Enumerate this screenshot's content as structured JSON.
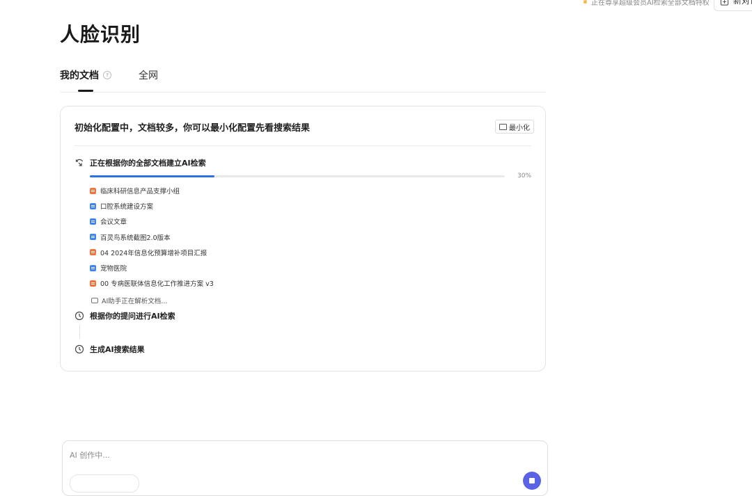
{
  "header": {
    "vip_notice": "正在尊享超级会员AI检索全部文档特权",
    "new_chat_label": "新对话"
  },
  "page": {
    "title": "人脸识别"
  },
  "tabs": [
    {
      "label": "我的文档",
      "active": true
    },
    {
      "label": "全网",
      "active": false
    }
  ],
  "card": {
    "title": "初始化配置中，文档较多，你可以最小化配置先看搜索结果",
    "minimize_label": "最小化",
    "steps": [
      {
        "label": "正在根据你的全部文档建立AI检索",
        "status": "in-progress"
      },
      {
        "label": "根据你的提问进行AI检索",
        "status": "pending"
      },
      {
        "label": "生成AI搜索结果",
        "status": "pending"
      }
    ],
    "progress": {
      "percent": 30,
      "label": "30%"
    },
    "documents": [
      {
        "name": "临床科研信息产品支撑小组",
        "icon": "orange-doc-icon"
      },
      {
        "name": "口腔系统建设方案",
        "icon": "blue-doc-icon"
      },
      {
        "name": "会议文章",
        "icon": "blue-doc-icon"
      },
      {
        "name": "百灵鸟系统截图2.0版本",
        "icon": "blue-doc-icon"
      },
      {
        "name": "04 2024年信息化预算增补项目汇报",
        "icon": "orange-doc-icon"
      },
      {
        "name": "宠物医院",
        "icon": "blue-doc-icon"
      },
      {
        "name": "00 专病医联体信息化工作推进方案 v3",
        "icon": "orange-doc-icon"
      }
    ],
    "assistant_status": "AI助手正在解析文档..."
  },
  "composer": {
    "placeholder": "AI 创作中..."
  },
  "colors": {
    "accent": "#2f6fe8",
    "send_button": "#5a63e6",
    "orange_doc": "#f4733a",
    "blue_doc": "#3e85f3"
  }
}
